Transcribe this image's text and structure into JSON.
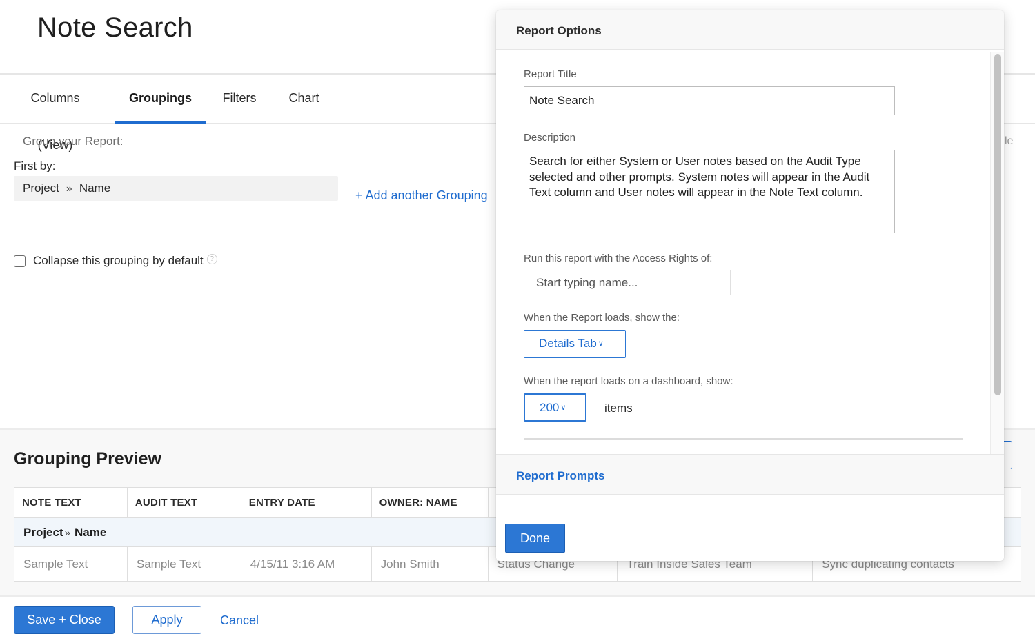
{
  "page": {
    "title": "Note Search"
  },
  "tabs": [
    {
      "label": "Columns (View)",
      "active": false
    },
    {
      "label": "Groupings",
      "active": true
    },
    {
      "label": "Filters",
      "active": false
    },
    {
      "label": "Chart",
      "active": false
    }
  ],
  "groupings": {
    "group_label": "Group your Report:",
    "first_by_label": "First by:",
    "first_by": {
      "object": "Project",
      "separator": "»",
      "field": "Name"
    },
    "add_grouping": "+ Add another Grouping",
    "collapse_label": "Collapse this grouping by default",
    "collapse_checked": false,
    "help_icon": "?",
    "partial_text": "le"
  },
  "preview": {
    "title": "Grouping Preview",
    "columns": [
      "NOTE TEXT",
      "AUDIT TEXT",
      "ENTRY DATE",
      "OWNER: NAME",
      "",
      "",
      ""
    ],
    "group_row": {
      "object": "Project",
      "separator": "»",
      "field": "Name"
    },
    "rows": [
      [
        "Sample Text",
        "Sample Text",
        "4/15/11 3:16 AM",
        "John Smith",
        "Status Change",
        "Train Inside Sales Team",
        "Sync duplicating contacts"
      ]
    ]
  },
  "footer": {
    "save_close": "Save + Close",
    "apply": "Apply",
    "cancel": "Cancel"
  },
  "modal": {
    "title": "Report Options",
    "report_title_label": "Report Title",
    "report_title_value": "Note Search",
    "description_label": "Description",
    "description_value": "Search for either System or User notes based on the Audit Type selected and other prompts. System notes will appear in the Audit Text column and User notes will appear in the Note Text column.",
    "access_rights_label": "Run this report with the Access Rights of:",
    "access_rights_placeholder": "Start typing name...",
    "load_show_label": "When the Report loads, show the:",
    "load_show_value": "Details Tab",
    "dashboard_label": "When the report loads on a dashboard, show:",
    "dashboard_value": "200",
    "dashboard_suffix": "items",
    "prompts_section": "Report Prompts",
    "done": "Done"
  },
  "colors": {
    "accent": "#1f6ccf",
    "primary_button": "#2c77d4",
    "group_row_bg": "#f1f6fb"
  }
}
